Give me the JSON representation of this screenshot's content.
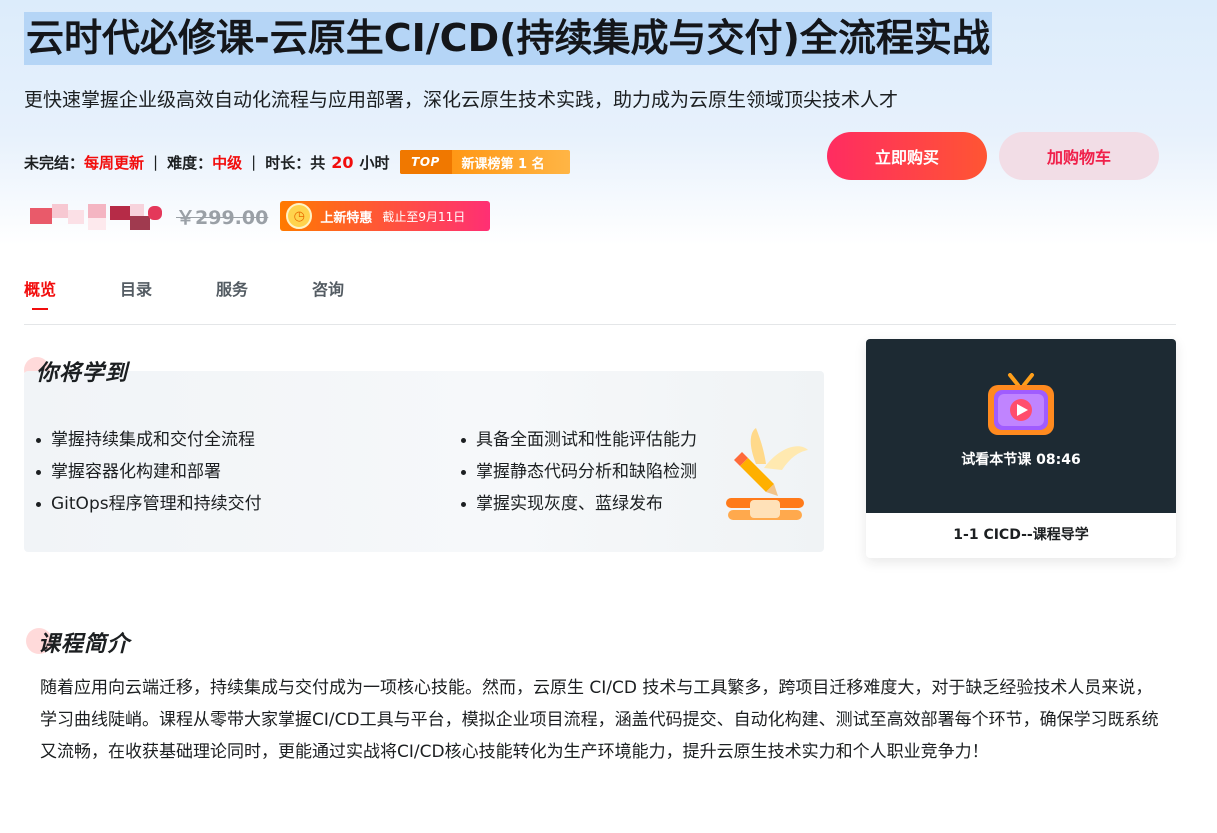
{
  "course": {
    "title": "云时代必修课-云原生CI/CD(持续集成与交付)全流程实战",
    "subtitle": "更快速掌握企业级高效自动化流程与应用部署，深化云原生技术实践，助力成为云原生领域顶尖技术人才"
  },
  "meta": {
    "status_label": "未完结：",
    "status_value": "每周更新",
    "difficulty_label": "难度：",
    "difficulty_value": "中级",
    "duration_label": "时长：",
    "duration_prefix": "共",
    "duration_value": "20",
    "duration_unit": "小时",
    "rank_tag": "TOP",
    "rank_text": "新课榜第 1 名"
  },
  "actions": {
    "buy_label": "立即购买",
    "cart_label": "加购物车"
  },
  "price": {
    "original": "￥299.00",
    "promo_label": "上新特惠",
    "promo_deadline": "截止至9月11日"
  },
  "tabs": [
    "概览",
    "目录",
    "服务",
    "咨询"
  ],
  "learn": {
    "heading": "你将学到",
    "left_items": [
      "掌握持续集成和交付全流程",
      "掌握容器化构建和部署",
      "GitOps程序管理和持续交付"
    ],
    "right_items": [
      "具备全面测试和性能评估能力",
      "掌握静态代码分析和缺陷检测",
      "掌握实现灰度、蓝绿发布"
    ]
  },
  "video": {
    "preview_label": "试看本节课 08:46",
    "lesson_title": "1-1 CICD--课程导学"
  },
  "intro": {
    "heading": "课程简介",
    "text": "随着应用向云端迁移，持续集成与交付成为一项核心技能。然而，云原生 CI/CD 技术与工具繁多，跨项目迁移难度大，对于缺乏经验技术人员来说，学习曲线陡峭。课程从零带大家掌握CI/CD工具与平台，模拟企业项目流程，涵盖代码提交、自动化构建、测试至高效部署每个环节，确保学习既系统又流畅，在收获基础理论同时，更能通过实战将CI/CD核心技能转化为生产环境能力，提升云原生技术实力和个人职业竞争力！"
  },
  "colors": {
    "accent_red": "#f20d0d",
    "buy_gradient_start": "#ff2c61",
    "buy_gradient_end": "#ff5533",
    "cart_bg": "#f2dde6",
    "title_highlight": "#b5d5f6",
    "video_bg": "#1d2a33"
  }
}
